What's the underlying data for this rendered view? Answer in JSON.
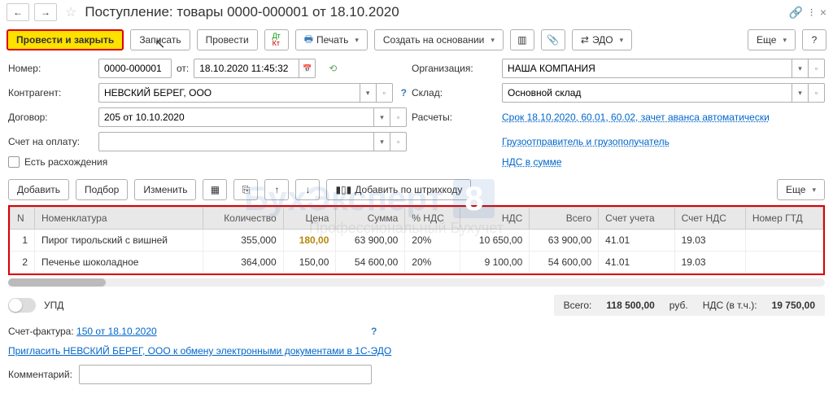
{
  "title": "Поступление: товары 0000-000001 от 18.10.2020",
  "toolbar": {
    "post_close": "Провести и закрыть",
    "save": "Записать",
    "post": "Провести",
    "print": "Печать",
    "create_based": "Создать на основании",
    "edo": "ЭДО",
    "more": "Еще"
  },
  "form": {
    "number_label": "Номер:",
    "number": "0000-000001",
    "from_label": "от:",
    "date": "18.10.2020 11:45:32",
    "org_label": "Организация:",
    "org": "НАША КОМПАНИЯ",
    "counterparty_label": "Контрагент:",
    "counterparty": "НЕВСКИЙ БЕРЕГ, ООО",
    "warehouse_label": "Склад:",
    "warehouse": "Основной склад",
    "contract_label": "Договор:",
    "contract": "205 от 10.10.2020",
    "settlements_label": "Расчеты:",
    "settlements_link": "Срок 18.10.2020, 60.01, 60.02, зачет аванса автоматически",
    "invoice_label": "Счет на оплату:",
    "shipper_link": "Грузоотправитель и грузополучатель",
    "discrepancy": "Есть расхождения",
    "vat_link": "НДС в сумме"
  },
  "table_toolbar": {
    "add": "Добавить",
    "pick": "Подбор",
    "edit": "Изменить",
    "barcode": "Добавить по штрихкоду",
    "more": "Еще"
  },
  "columns": {
    "n": "N",
    "item": "Номенклатура",
    "qty": "Количество",
    "price": "Цена",
    "sum": "Сумма",
    "vat_pct": "% НДС",
    "vat": "НДС",
    "total": "Всего",
    "account": "Счет учета",
    "vat_account": "Счет НДС",
    "gtd": "Номер ГТД"
  },
  "rows": [
    {
      "n": "1",
      "item": "Пирог тирольский с вишней",
      "qty": "355,000",
      "price": "180,00",
      "sum": "63 900,00",
      "vat_pct": "20%",
      "vat": "10 650,00",
      "total": "63 900,00",
      "account": "41.01",
      "vat_account": "19.03"
    },
    {
      "n": "2",
      "item": "Печенье шоколадное",
      "qty": "364,000",
      "price": "150,00",
      "sum": "54 600,00",
      "vat_pct": "20%",
      "vat": "9 100,00",
      "total": "54 600,00",
      "account": "41.01",
      "vat_account": "19.03"
    }
  ],
  "totals": {
    "upd": "УПД",
    "total_label": "Всего:",
    "total": "118 500,00",
    "currency": "руб.",
    "vat_label": "НДС (в т.ч.):",
    "vat": "19 750,00"
  },
  "footer": {
    "invoice_fact_label": "Счет-фактура:",
    "invoice_fact_link": "150 от 18.10.2020",
    "edo_invite": "Пригласить НЕВСКИЙ БЕРЕГ, ООО к обмену электронными документами в 1С-ЭДО",
    "comment_label": "Комментарий:"
  },
  "watermark": "БухЭксперт",
  "watermark_sub": "Профессиональный Бухучет"
}
